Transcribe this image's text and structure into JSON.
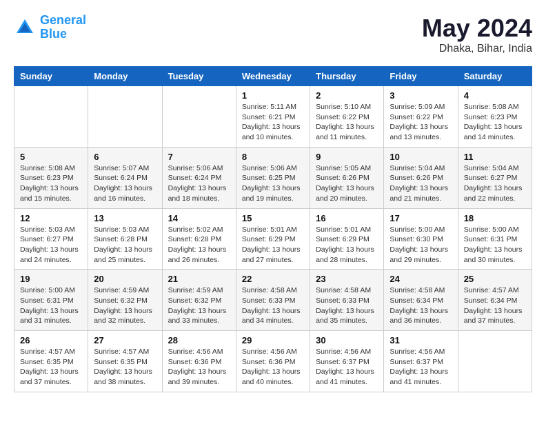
{
  "header": {
    "logo_line1": "General",
    "logo_line2": "Blue",
    "month_year": "May 2024",
    "location": "Dhaka, Bihar, India"
  },
  "weekdays": [
    "Sunday",
    "Monday",
    "Tuesday",
    "Wednesday",
    "Thursday",
    "Friday",
    "Saturday"
  ],
  "weeks": [
    [
      {
        "day": "",
        "info": ""
      },
      {
        "day": "",
        "info": ""
      },
      {
        "day": "",
        "info": ""
      },
      {
        "day": "1",
        "info": "Sunrise: 5:11 AM\nSunset: 6:21 PM\nDaylight: 13 hours\nand 10 minutes."
      },
      {
        "day": "2",
        "info": "Sunrise: 5:10 AM\nSunset: 6:22 PM\nDaylight: 13 hours\nand 11 minutes."
      },
      {
        "day": "3",
        "info": "Sunrise: 5:09 AM\nSunset: 6:22 PM\nDaylight: 13 hours\nand 13 minutes."
      },
      {
        "day": "4",
        "info": "Sunrise: 5:08 AM\nSunset: 6:23 PM\nDaylight: 13 hours\nand 14 minutes."
      }
    ],
    [
      {
        "day": "5",
        "info": "Sunrise: 5:08 AM\nSunset: 6:23 PM\nDaylight: 13 hours\nand 15 minutes."
      },
      {
        "day": "6",
        "info": "Sunrise: 5:07 AM\nSunset: 6:24 PM\nDaylight: 13 hours\nand 16 minutes."
      },
      {
        "day": "7",
        "info": "Sunrise: 5:06 AM\nSunset: 6:24 PM\nDaylight: 13 hours\nand 18 minutes."
      },
      {
        "day": "8",
        "info": "Sunrise: 5:06 AM\nSunset: 6:25 PM\nDaylight: 13 hours\nand 19 minutes."
      },
      {
        "day": "9",
        "info": "Sunrise: 5:05 AM\nSunset: 6:26 PM\nDaylight: 13 hours\nand 20 minutes."
      },
      {
        "day": "10",
        "info": "Sunrise: 5:04 AM\nSunset: 6:26 PM\nDaylight: 13 hours\nand 21 minutes."
      },
      {
        "day": "11",
        "info": "Sunrise: 5:04 AM\nSunset: 6:27 PM\nDaylight: 13 hours\nand 22 minutes."
      }
    ],
    [
      {
        "day": "12",
        "info": "Sunrise: 5:03 AM\nSunset: 6:27 PM\nDaylight: 13 hours\nand 24 minutes."
      },
      {
        "day": "13",
        "info": "Sunrise: 5:03 AM\nSunset: 6:28 PM\nDaylight: 13 hours\nand 25 minutes."
      },
      {
        "day": "14",
        "info": "Sunrise: 5:02 AM\nSunset: 6:28 PM\nDaylight: 13 hours\nand 26 minutes."
      },
      {
        "day": "15",
        "info": "Sunrise: 5:01 AM\nSunset: 6:29 PM\nDaylight: 13 hours\nand 27 minutes."
      },
      {
        "day": "16",
        "info": "Sunrise: 5:01 AM\nSunset: 6:29 PM\nDaylight: 13 hours\nand 28 minutes."
      },
      {
        "day": "17",
        "info": "Sunrise: 5:00 AM\nSunset: 6:30 PM\nDaylight: 13 hours\nand 29 minutes."
      },
      {
        "day": "18",
        "info": "Sunrise: 5:00 AM\nSunset: 6:31 PM\nDaylight: 13 hours\nand 30 minutes."
      }
    ],
    [
      {
        "day": "19",
        "info": "Sunrise: 5:00 AM\nSunset: 6:31 PM\nDaylight: 13 hours\nand 31 minutes."
      },
      {
        "day": "20",
        "info": "Sunrise: 4:59 AM\nSunset: 6:32 PM\nDaylight: 13 hours\nand 32 minutes."
      },
      {
        "day": "21",
        "info": "Sunrise: 4:59 AM\nSunset: 6:32 PM\nDaylight: 13 hours\nand 33 minutes."
      },
      {
        "day": "22",
        "info": "Sunrise: 4:58 AM\nSunset: 6:33 PM\nDaylight: 13 hours\nand 34 minutes."
      },
      {
        "day": "23",
        "info": "Sunrise: 4:58 AM\nSunset: 6:33 PM\nDaylight: 13 hours\nand 35 minutes."
      },
      {
        "day": "24",
        "info": "Sunrise: 4:58 AM\nSunset: 6:34 PM\nDaylight: 13 hours\nand 36 minutes."
      },
      {
        "day": "25",
        "info": "Sunrise: 4:57 AM\nSunset: 6:34 PM\nDaylight: 13 hours\nand 37 minutes."
      }
    ],
    [
      {
        "day": "26",
        "info": "Sunrise: 4:57 AM\nSunset: 6:35 PM\nDaylight: 13 hours\nand 37 minutes."
      },
      {
        "day": "27",
        "info": "Sunrise: 4:57 AM\nSunset: 6:35 PM\nDaylight: 13 hours\nand 38 minutes."
      },
      {
        "day": "28",
        "info": "Sunrise: 4:56 AM\nSunset: 6:36 PM\nDaylight: 13 hours\nand 39 minutes."
      },
      {
        "day": "29",
        "info": "Sunrise: 4:56 AM\nSunset: 6:36 PM\nDaylight: 13 hours\nand 40 minutes."
      },
      {
        "day": "30",
        "info": "Sunrise: 4:56 AM\nSunset: 6:37 PM\nDaylight: 13 hours\nand 41 minutes."
      },
      {
        "day": "31",
        "info": "Sunrise: 4:56 AM\nSunset: 6:37 PM\nDaylight: 13 hours\nand 41 minutes."
      },
      {
        "day": "",
        "info": ""
      }
    ]
  ]
}
